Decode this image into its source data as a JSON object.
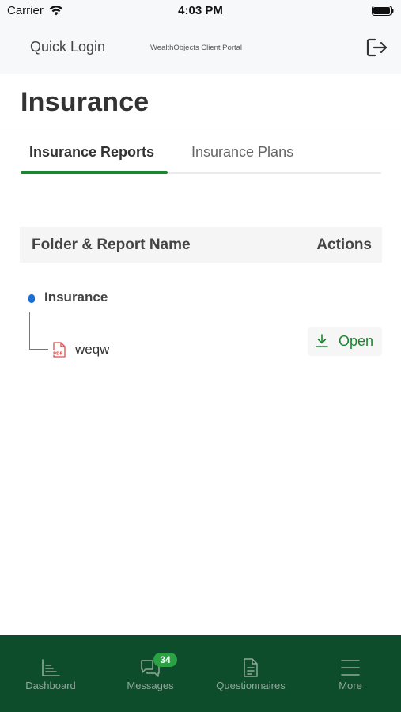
{
  "status_bar": {
    "carrier": "Carrier",
    "time": "4:03 PM"
  },
  "header": {
    "left_title": "Quick Login",
    "portal_title": "WealthObjects Client Portal",
    "logout_icon": "logout-icon"
  },
  "page": {
    "title": "Insurance"
  },
  "tabs": [
    {
      "label": "Insurance Reports",
      "active": true
    },
    {
      "label": "Insurance Plans",
      "active": false
    }
  ],
  "table": {
    "columns": [
      "Folder & Report Name",
      "Actions"
    ],
    "folders": [
      {
        "name": "Insurance",
        "files": [
          {
            "name": "weqw",
            "file_type_icon": "pdf-icon",
            "action_label": "Open",
            "action_icon": "download-icon"
          }
        ]
      }
    ]
  },
  "bottom_nav": {
    "items": [
      {
        "label": "Dashboard",
        "icon": "dashboard-icon"
      },
      {
        "label": "Messages",
        "icon": "messages-icon",
        "badge": "34"
      },
      {
        "label": "Questionnaires",
        "icon": "document-icon"
      },
      {
        "label": "More",
        "icon": "menu-icon"
      }
    ]
  },
  "colors": {
    "accent_green": "#19872f",
    "nav_background": "#0e4d2c",
    "badge_green": "#2aa244",
    "folder_blue": "#1a6fd6",
    "pdf_red": "#e04b4b"
  }
}
